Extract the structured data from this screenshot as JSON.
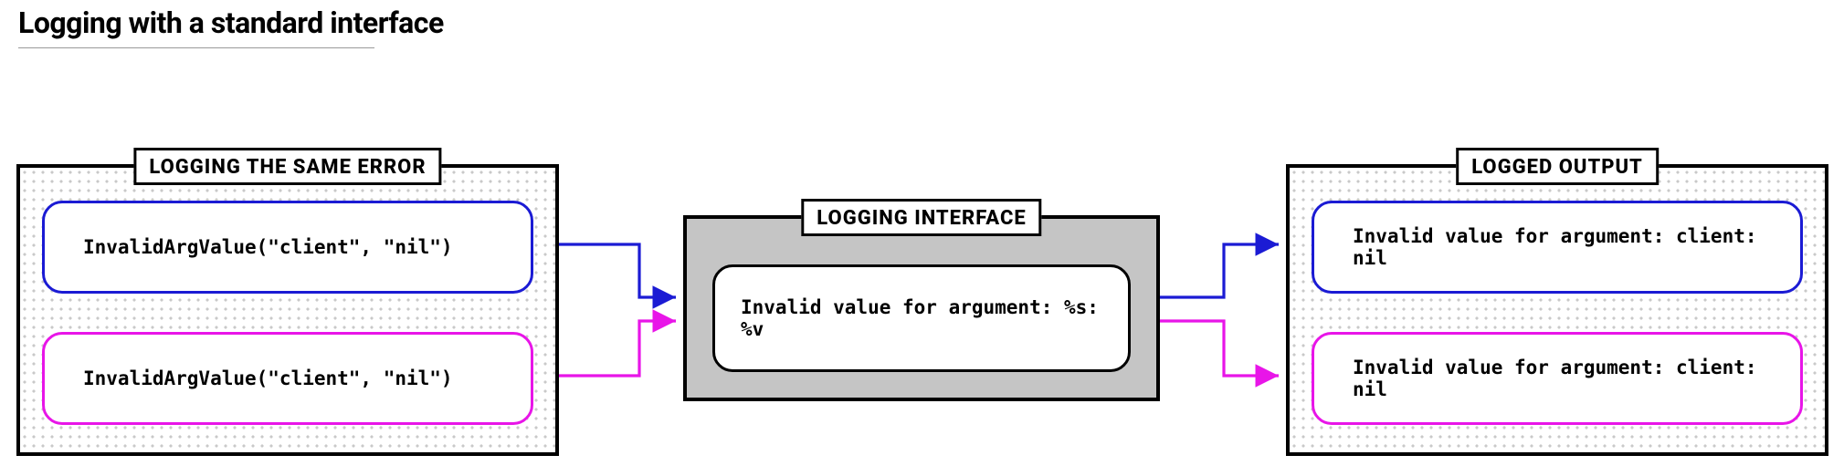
{
  "title": "Logging with a standard interface",
  "panels": {
    "left": {
      "label": "LOGGING THE SAME ERROR",
      "box_top": "InvalidArgValue(\"client\", \"nil\")",
      "box_bottom": "InvalidArgValue(\"client\", \"nil\")"
    },
    "center": {
      "label": "LOGGING INTERFACE",
      "template": "Invalid value for argument: %s: %v"
    },
    "right": {
      "label": "LOGGED OUTPUT",
      "box_top": "Invalid value for argument: client: nil",
      "box_bottom": "Invalid value for argument: client: nil"
    }
  },
  "colors": {
    "blue": "#1b1bd4",
    "magenta": "#e815e8"
  }
}
